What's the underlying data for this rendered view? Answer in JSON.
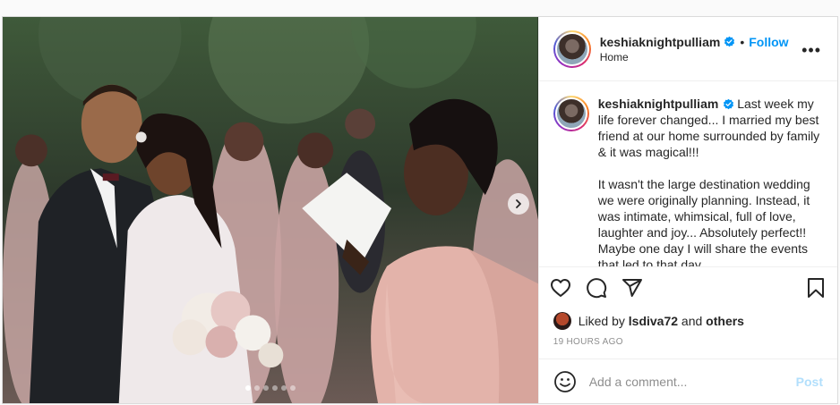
{
  "post": {
    "username": "keshiaknightpulliam",
    "follow_label": "Follow",
    "bullet": "•",
    "location": "Home",
    "more_label": "•••"
  },
  "caption": {
    "username": "keshiaknightpulliam",
    "text": "Last week my life forever changed... I married my best friend at our home surrounded by family & it was magical!!!\n\nIt wasn't the large destination wedding we were originally planning. Instead, it was intimate, whimsical, full of love, laughter and joy... Absolutely perfect!! Maybe one day I will share the events that led to that day..."
  },
  "likes": {
    "prefix": "Liked by",
    "user": "lsdiva72",
    "joiner": "and",
    "others": "others"
  },
  "timestamp": "19 HOURS AGO",
  "comment": {
    "placeholder": "Add a comment...",
    "post_label": "Post"
  },
  "carousel": {
    "slide_count": 6,
    "active_index": 0
  },
  "colors": {
    "accent": "#0095f6",
    "post_disabled": "#b2dffc",
    "muted": "#8e8e8e"
  },
  "icons": [
    "verified-badge-icon",
    "more-options-icon",
    "heart-icon",
    "comment-icon",
    "share-icon",
    "bookmark-icon",
    "emoji-icon",
    "chevron-right-icon"
  ]
}
